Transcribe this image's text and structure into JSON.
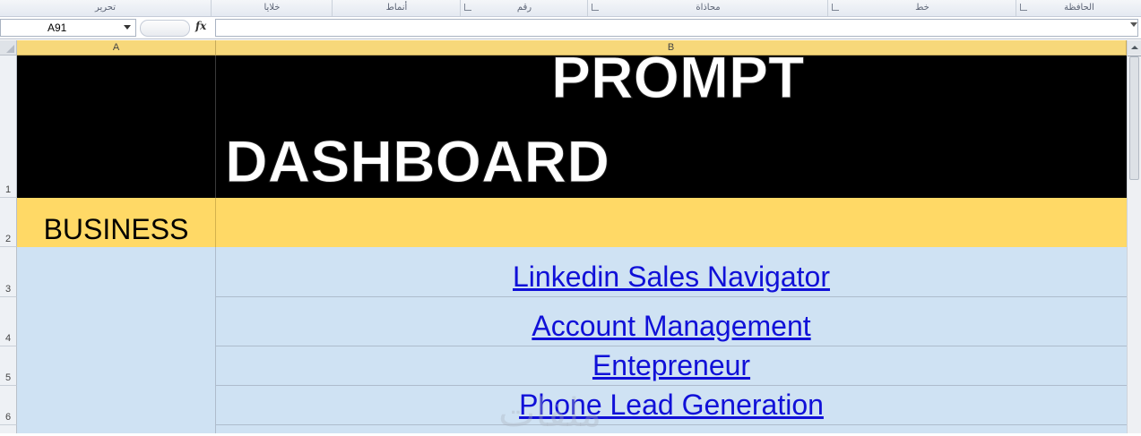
{
  "ribbon": {
    "groups": [
      "الحافظة",
      "خط",
      "محاذاة",
      "رقم",
      "أنماط",
      "خلايا",
      "تحرير"
    ]
  },
  "formula_bar": {
    "name_box": "A91",
    "fx_label": "fx",
    "formula": ""
  },
  "columns": [
    "A",
    "B"
  ],
  "rows": [
    "1",
    "2",
    "3",
    "4",
    "5",
    "6"
  ],
  "sheet": {
    "title_line1": "PROMPT",
    "title_line2": "DASHBOARD",
    "category": "BUSINESS",
    "links": [
      "Linkedin Sales Navigator",
      "Account Management",
      "Entepreneur",
      "Phone Lead Generation"
    ]
  },
  "watermark": "ملفات",
  "colors": {
    "header_yellow": "#ffd966",
    "title_bg": "#000000",
    "list_bg": "#cfe2f3",
    "link_blue": "#1010d8"
  }
}
